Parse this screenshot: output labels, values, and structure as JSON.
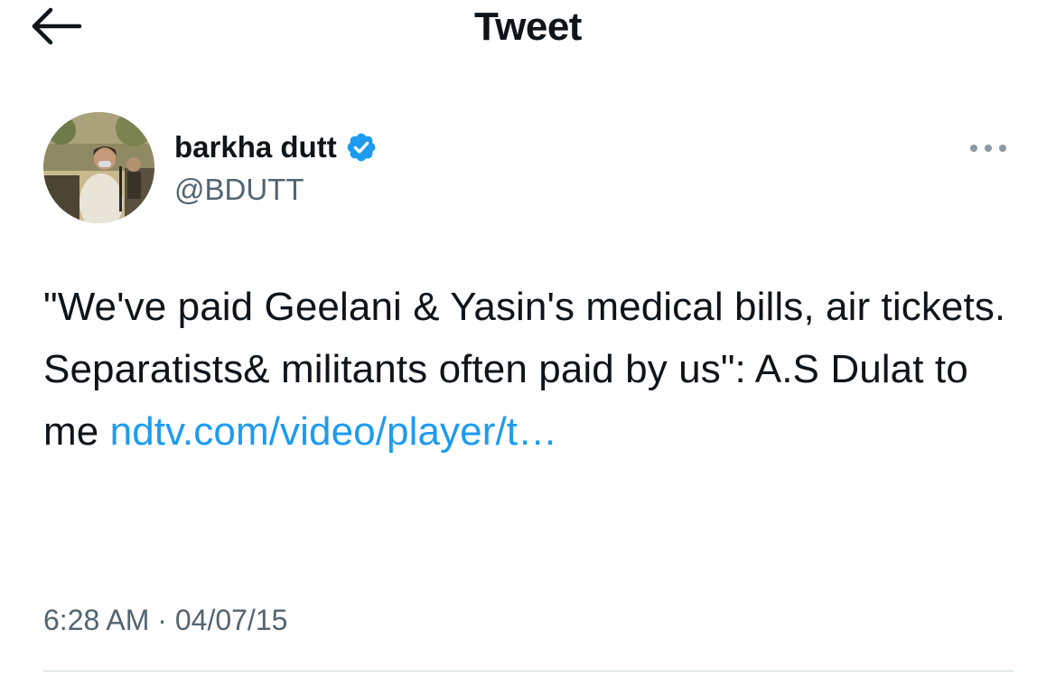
{
  "header": {
    "title": "Tweet",
    "back_icon": "arrow-left-icon"
  },
  "author": {
    "display_name": "barkha dutt",
    "handle": "@BDUTT",
    "verified": true,
    "verified_icon": "verified-badge-icon",
    "avatar": "profile-photo"
  },
  "more_icon": "more-horizontal-icon",
  "tweet": {
    "text": "\"We've paid Geelani & Yasin's medical bills, air tickets. Separatists& militants often paid by us\": A.S Dulat to me ",
    "link_text": "ndtv.com/video/​player/t…"
  },
  "meta": {
    "timestamp": "6:28 AM · 04/07/15"
  },
  "colors": {
    "text": "#0f1419",
    "secondary": "#536471",
    "accent": "#1d9bf0",
    "divider": "#cfd9de"
  }
}
